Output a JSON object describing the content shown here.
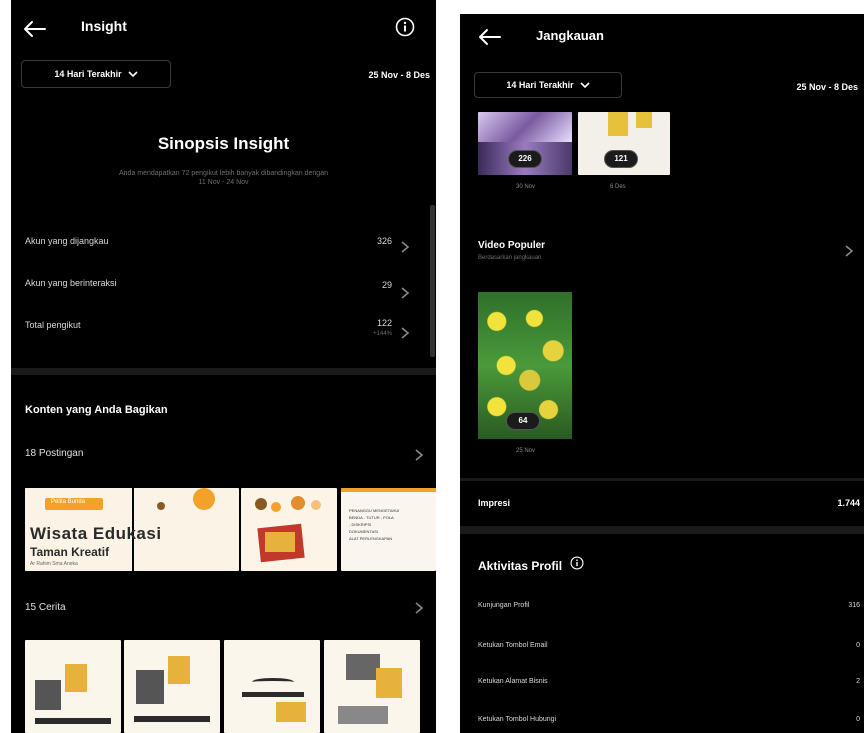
{
  "left": {
    "title": "Insight",
    "date_dropdown": "14 Hari Terakhir",
    "date_range": "25 Nov - 8 Des",
    "synopsis": {
      "title": "Sinopsis Insight",
      "subtitle_line1": "Anda mendapatkan 72 pengikut lebih banyak dibandingkan dengan",
      "subtitle_line2": "11 Nov - 24 Nov"
    },
    "metrics": [
      {
        "label": "Akun yang dijangkau",
        "value": "326"
      },
      {
        "label": "Akun yang berinteraksi",
        "value": "29"
      },
      {
        "label": "Total pengikut",
        "value": "122",
        "sub": "+144%"
      }
    ],
    "content_title": "Konten yang Anda Bagikan",
    "posts_label": "18 Postingan",
    "stories_label": "15 Cerita",
    "post_thumbs": {
      "tag": "Pelita Bunda",
      "title_line1": "Wisata Edukasi",
      "title_line2": "Taman Kreatif",
      "tiny": "Ar Rahim Sma Aneka"
    },
    "doc_thumb": {
      "line1": "PENANGGU MENGETAHUI",
      "line2": "BENDA - TUTUR - POLA",
      "line3": "- DISKRIPSI",
      "line4": "DOKUMENTASI",
      "line5": "ALAT PERLENGKAPAN"
    }
  },
  "right": {
    "title": "Jangkauan",
    "date_dropdown": "14 Hari Terakhir",
    "date_range": "25 Nov - 8 Des",
    "top_thumbs": [
      {
        "count": "226",
        "date": "30 Nov"
      },
      {
        "count": "121",
        "date": "6 Des"
      }
    ],
    "video_title": "Video Populer",
    "video_sub": "Berdasarkan jangkauan",
    "video_count": "64",
    "video_date": "25 Nov",
    "impressions_label": "Impresi",
    "impressions_value": "1.744",
    "profile_title": "Aktivitas Profil",
    "profile_rows": [
      {
        "label": "Kunjungan Profil",
        "value": "316"
      },
      {
        "label": "Ketukan Tombol Email",
        "value": "0"
      },
      {
        "label": "Ketukan Alamat Bisnis",
        "value": "2"
      },
      {
        "label": "Ketukan Tombol Hubungi",
        "value": "0"
      }
    ]
  },
  "colors": {
    "background": "#000000",
    "divider": "#1a1a1a",
    "muted_text": "#8a8a8a",
    "poster_cream": "#fbf3e6",
    "poster_orange": "#f4a12a"
  }
}
